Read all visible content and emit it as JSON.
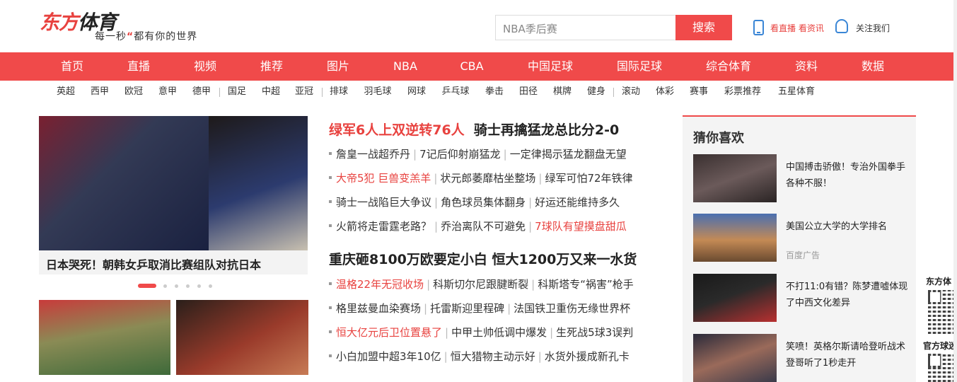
{
  "logo": {
    "main_red": "东方",
    "main_dark": "体育",
    "tagline_pre": "每一秒",
    "tagline_quote": "“",
    "tagline_post": "都有你的世界"
  },
  "search": {
    "placeholder": "NBA季后赛",
    "button": "搜索"
  },
  "header_links": {
    "live": "看直播 看资讯",
    "follow": "关注我们"
  },
  "main_nav": [
    "首页",
    "直播",
    "视频",
    "推荐",
    "图片",
    "NBA",
    "CBA",
    "中国足球",
    "国际足球",
    "综合体育",
    "资料",
    "数据"
  ],
  "sub_nav": [
    "英超",
    "西甲",
    "欧冠",
    "意甲",
    "德甲",
    "国足",
    "中超",
    "亚冠",
    "排球",
    "羽毛球",
    "网球",
    "乒乓球",
    "拳击",
    "田径",
    "棋牌",
    "健身",
    "滚动",
    "体彩",
    "赛事",
    "彩票推荐",
    "五星体育"
  ],
  "slide": {
    "caption": "日本哭死！朝韩女乒取消比赛组队对抗日本",
    "dot_count": 6,
    "active_dot": 0
  },
  "news": {
    "headline1": {
      "red": "绿军6人上双逆转76人",
      "rest": "骑士再擒猛龙总比分2-0"
    },
    "group1": [
      [
        {
          "t": "詹皇一战超乔丹",
          "red": false
        },
        {
          "t": "7记后仰射崩猛龙",
          "red": false
        },
        {
          "t": "一定律揭示猛龙翻盘无望",
          "red": false
        }
      ],
      [
        {
          "t": "大帝5犯 巨兽变羔羊",
          "red": true
        },
        {
          "t": "状元郎萎靡枯坐整场",
          "red": false
        },
        {
          "t": "绿军可怕72年铁律",
          "red": false
        }
      ],
      [
        {
          "t": "骑士一战陷巨大争议",
          "red": false
        },
        {
          "t": "角色球员集体翻身",
          "red": false
        },
        {
          "t": "好运还能维持多久",
          "red": false
        }
      ],
      [
        {
          "t": "火箭将走雷霆老路？",
          "red": false
        },
        {
          "t": "乔治离队不可避免",
          "red": false
        },
        {
          "t": "7球队有望摸盘甜瓜",
          "red": true
        }
      ]
    ],
    "headline2": {
      "red": "",
      "rest": "重庆砸8100万欧要定小白  恒大1200万又来一水货"
    },
    "group2": [
      [
        {
          "t": "温格22年无冠收场",
          "red": true
        },
        {
          "t": "科斯切尔尼跟腱断裂",
          "red": false
        },
        {
          "t": "科斯塔专“祸害”枪手",
          "red": false
        }
      ],
      [
        {
          "t": "格里兹曼血染赛场",
          "red": false
        },
        {
          "t": "托雷斯迎里程碑",
          "red": false
        },
        {
          "t": "法国铁卫重伤无缘世界杯",
          "red": false
        }
      ],
      [
        {
          "t": "恒大亿元后卫位置悬了",
          "red": true
        },
        {
          "t": "中甲土帅低调中爆发",
          "red": false
        },
        {
          "t": "生死战5球3误判",
          "red": false
        }
      ],
      [
        {
          "t": "小白加盟中超3年10亿",
          "red": false
        },
        {
          "t": "恒大猎物主动示好",
          "red": false
        },
        {
          "t": "水货外援成新孔卡",
          "red": false
        }
      ]
    ]
  },
  "guess": {
    "title": "猜你喜欢",
    "items": [
      {
        "text": "中国搏击骄傲！专治外国拳手各种不服！",
        "ad": ""
      },
      {
        "text": "美国公立大学的大学排名",
        "ad": "百度广告"
      },
      {
        "text": "不打11:0有错？陈梦遭嘘体现了中西文化差异",
        "ad": ""
      },
      {
        "text": "笑喷！英格尔斯请哈登听战术 登哥听了1秒走开",
        "ad": ""
      }
    ]
  },
  "float": {
    "label1": "东方体",
    "label2": "官方球迷"
  },
  "colors": {
    "brand_red": "#f04a4a",
    "text": "#333333",
    "link_blue": "#3a86d6"
  }
}
